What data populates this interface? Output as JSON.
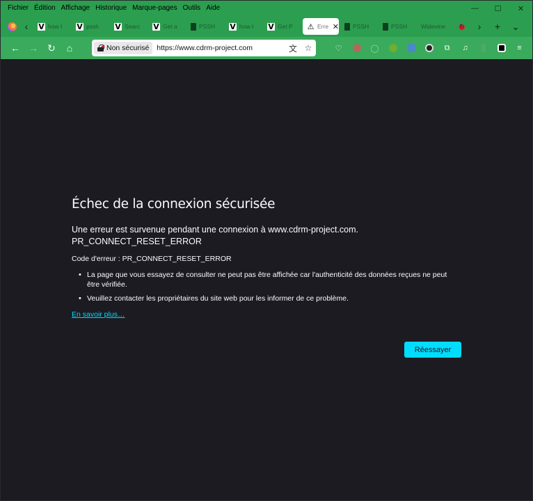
{
  "menu": {
    "items": [
      "Fichier",
      "Édition",
      "Affichage",
      "Historique",
      "Marque-pages",
      "Outils",
      "Aide"
    ]
  },
  "window_controls": {
    "minimize": "—",
    "maximize": "☐",
    "close": "✕"
  },
  "tabs": [
    {
      "icon": "v-logo-icon",
      "fav": "V",
      "label": "how t"
    },
    {
      "icon": "v-logo-icon",
      "fav": "V",
      "label": "pssh"
    },
    {
      "icon": "v-logo-icon",
      "fav": "V",
      "label": "Searc"
    },
    {
      "icon": "v-logo-icon",
      "fav": "V",
      "label": "Get a"
    },
    {
      "icon": "file-icon",
      "fav": "",
      "label": "PSSH"
    },
    {
      "icon": "v-logo-icon",
      "fav": "V",
      "label": "how t"
    },
    {
      "icon": "v-logo-icon",
      "fav": "V",
      "label": "Get P"
    },
    {
      "icon": "warning-icon",
      "fav": "⚠",
      "label": "Erre",
      "active": true
    },
    {
      "icon": "file-icon",
      "fav": "",
      "label": "PSSH"
    },
    {
      "icon": "file-icon",
      "fav": "",
      "label": "PSSH"
    },
    {
      "icon": "",
      "fav": "",
      "label": "Widevine"
    },
    {
      "icon": "bug-icon",
      "fav": "🐞",
      "label": ""
    }
  ],
  "tab_close": "✕",
  "tab_controls": {
    "scroll_left": "‹",
    "scroll_right": "›",
    "new_tab": "+",
    "list_all": "⌄"
  },
  "nav": {
    "back": "←",
    "forward": "→",
    "reload": "↻",
    "home": "⌂"
  },
  "urlbar": {
    "security_label": "Non sécurisé",
    "url": "https://www.cdrm-project.com",
    "translate_icon": "文",
    "bookmark_icon": "☆"
  },
  "extensions": [
    {
      "name": "pocket-icon",
      "glyph": "♡",
      "color": "#f4fff6"
    },
    {
      "name": "extension-avatar-icon",
      "glyph": "",
      "color": "#b06a5a"
    },
    {
      "name": "extension-ring-icon",
      "glyph": "◯",
      "color": "#9bd8ad"
    },
    {
      "name": "extension-globe-icon",
      "glyph": "",
      "color": "#6fae2f"
    },
    {
      "name": "extension-screen-icon",
      "glyph": "",
      "color": "#4b88c9"
    },
    {
      "name": "extension-ball-icon",
      "glyph": "",
      "color": "#222222"
    },
    {
      "name": "extensions-puzzle-icon",
      "glyph": "⧉",
      "color": "#f4fff6"
    },
    {
      "name": "music-note-icon",
      "glyph": "♫",
      "color": "#f4fff6"
    },
    {
      "name": "extension-leaf-icon",
      "glyph": "",
      "color": "#4ea86a"
    },
    {
      "name": "extension-tampermonkey-icon",
      "glyph": "",
      "color": "#000000"
    },
    {
      "name": "app-menu-icon",
      "glyph": "≡",
      "color": "#f4fff6"
    }
  ],
  "error": {
    "title": "Échec de la connexion sécurisée",
    "description_line1": "Une erreur est survenue pendant une connexion à www.cdrm-project.com.",
    "description_line2": "PR_CONNECT_RESET_ERROR",
    "code_line": "Code d'erreur : PR_CONNECT_RESET_ERROR",
    "bullets": [
      "La page que vous essayez de consulter ne peut pas être affichée car l'authenticité des données reçues ne peut être vérifiée.",
      "Veuillez contacter les propriétaires du site web pour les informer de ce problème."
    ],
    "learn_more": "En savoir plus…",
    "retry_button": "Réessayer"
  },
  "colors": {
    "accent": "#00ddff",
    "toolbar_green": "#3aaa5c",
    "tabbar_green": "#2b9f4f",
    "background": "#1c1b22"
  }
}
